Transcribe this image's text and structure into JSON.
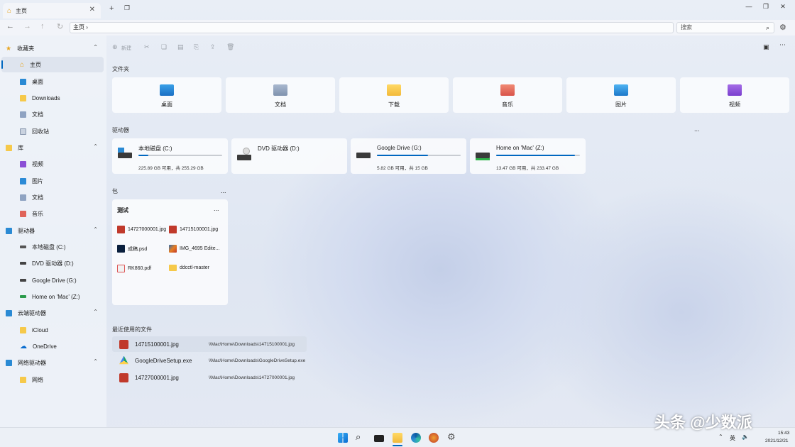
{
  "tab": {
    "title": "主页"
  },
  "nav": {
    "address": "主页 ›",
    "search_placeholder": "搜索"
  },
  "sidebar": {
    "sections": [
      {
        "header": "收藏夹",
        "items": [
          "主页",
          "桌面",
          "Downloads",
          "文档",
          "回收站"
        ]
      },
      {
        "header": "库",
        "items": [
          "视频",
          "图片",
          "文档",
          "音乐"
        ]
      },
      {
        "header": "驱动器",
        "items": [
          "本地磁盘 (C:)",
          "DVD 驱动器 (D:)",
          "Google Drive (G:)",
          "Home on 'Mac' (Z:)"
        ]
      },
      {
        "header": "云端驱动器",
        "items": [
          "iCloud",
          "OneDrive"
        ]
      },
      {
        "header": "网络驱动器",
        "items": [
          "网络"
        ]
      }
    ]
  },
  "toolbar": {
    "new_label": "新建"
  },
  "folders": {
    "title": "文件夹",
    "items": [
      "桌面",
      "文档",
      "下载",
      "音乐",
      "图片",
      "视频"
    ]
  },
  "drives": {
    "title": "驱动器",
    "items": [
      {
        "name": "本地磁盘 (C:)",
        "stats": "225.89 GB 可用，共 255.29 GB",
        "used_pct": 12
      },
      {
        "name": "DVD 驱动器 (D:)",
        "stats": "",
        "used_pct": null
      },
      {
        "name": "Google Drive (G:)",
        "stats": "5.82 GB 可用，共 15 GB",
        "used_pct": 61
      },
      {
        "name": "Home on 'Mac' (Z:)",
        "stats": "13.47 GB 可用，共 233.47 GB",
        "used_pct": 94
      }
    ],
    "more": "..."
  },
  "bundles": {
    "title": "包",
    "more": "...",
    "card": {
      "title": "测试",
      "more": "...",
      "files": [
        "14727000001.jpg",
        "14715100001.jpg",
        "成稿.psd",
        "IMG_4695 Edite...",
        "RK860.pdf",
        "ddcctl-master"
      ]
    }
  },
  "recent": {
    "title": "最近使用的文件",
    "items": [
      {
        "name": "14715100001.jpg",
        "path": "\\\\Mac\\Home\\Downloads\\14715100001.jpg"
      },
      {
        "name": "GoogleDriveSetup.exe",
        "path": "\\\\Mac\\Home\\Downloads\\GoogleDriveSetup.exe"
      },
      {
        "name": "14727000001.jpg",
        "path": "\\\\Mac\\Home\\Downloads\\14727000001.jpg"
      }
    ]
  },
  "taskbar": {
    "ime": "英",
    "time": "15:43",
    "date": "2021/12/21"
  },
  "watermark": "头条 @少数派",
  "colors": {
    "accent": "#0067c0"
  }
}
